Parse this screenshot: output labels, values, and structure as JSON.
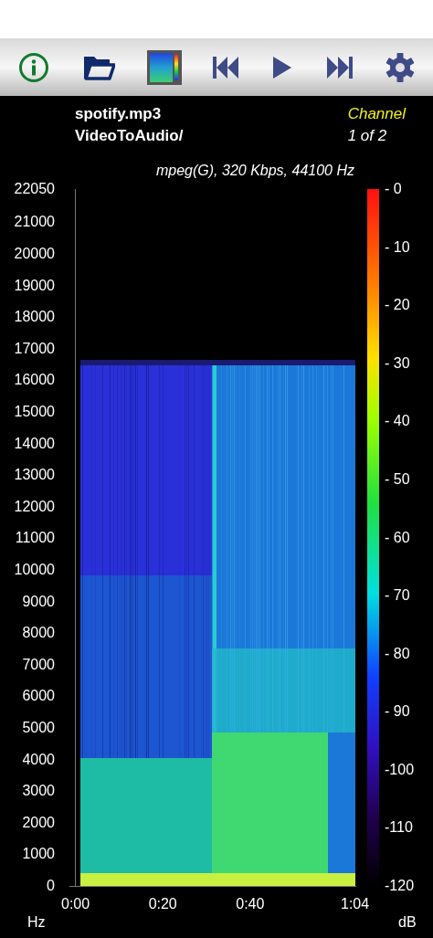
{
  "file": {
    "name": "spotify.mp3",
    "folder": "VideoToAudio/"
  },
  "channel": {
    "label": "Channel",
    "value": "1 of 2"
  },
  "format": "mpeg(G), 320 Kbps, 44100 Hz",
  "y_axis": {
    "unit": "Hz",
    "ticks": [
      "22050",
      "21000",
      "20000",
      "19000",
      "18000",
      "17000",
      "16000",
      "15000",
      "14000",
      "13000",
      "12000",
      "11000",
      "10000",
      "9000",
      "8000",
      "7000",
      "6000",
      "5000",
      "4000",
      "3000",
      "2000",
      "1000",
      "0"
    ]
  },
  "x_axis": {
    "ticks": [
      "0:00",
      "0:20",
      "0:40",
      "1:04"
    ]
  },
  "color_scale": {
    "unit": "dB",
    "ticks": [
      "- 0",
      "- 10",
      "- 20",
      "- 30",
      "- 40",
      "- 50",
      "- 60",
      "- 70",
      "- 80",
      "- 90",
      "-100",
      "-110",
      "-120"
    ]
  }
}
